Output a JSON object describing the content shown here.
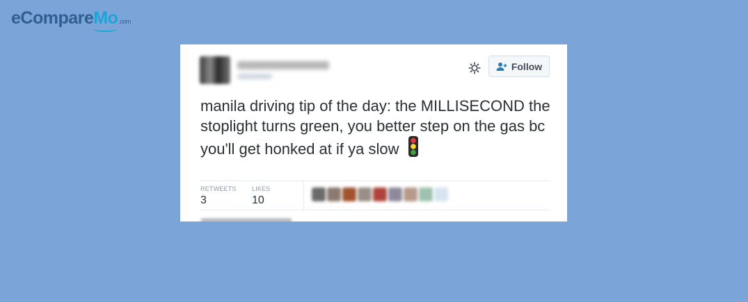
{
  "logo": {
    "part1": "eCompare",
    "part2": "Mo",
    "suffix": ".com"
  },
  "tweet": {
    "follow_label": "Follow",
    "text": "manila driving tip of the day: the MILLISECOND the stoplight turns green, you better step on the gas bc you'll get honked at if ya slow",
    "stats": {
      "retweets_label": "RETWEETS",
      "retweets_value": "3",
      "likes_label": "LIKES",
      "likes_value": "10"
    }
  },
  "colors": {
    "background": "#7ba5d8",
    "logo_dark": "#2e5e93",
    "logo_accent": "#1fa4d6",
    "text": "#292f33",
    "muted": "#8899a6"
  },
  "icons": [
    "gear-icon",
    "add-user-icon",
    "traffic-light-icon"
  ]
}
